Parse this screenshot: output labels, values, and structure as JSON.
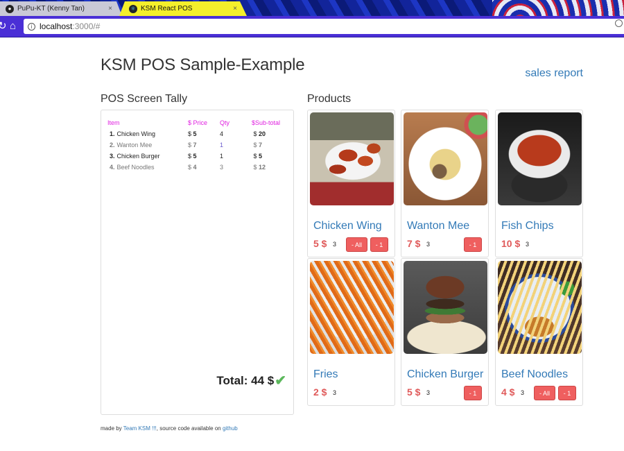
{
  "browser": {
    "tabs": [
      {
        "label": "PuPu-KT (Kenny Tan)",
        "close": "×",
        "active": false
      },
      {
        "label": "KSM React POS",
        "close": "×",
        "active": true
      }
    ],
    "url_host": "localhost",
    "url_path": ":3000/#"
  },
  "page": {
    "title": "KSM POS Sample-Example",
    "sales_report_link": "sales report",
    "tally_heading": "POS Screen Tally",
    "products_heading": "Products"
  },
  "tally": {
    "headers": {
      "item": "Item",
      "price": "$ Price",
      "qty": "Qty",
      "subtotal": "$Sub-total"
    },
    "rows": [
      {
        "idx": "1.",
        "item": "Chicken Wing",
        "price_sym": "$",
        "price": "5",
        "qty": "4",
        "sub_sym": "$",
        "subtotal": "20"
      },
      {
        "idx": "2.",
        "item": "Wanton Mee",
        "price_sym": "$",
        "price": "7",
        "qty": "1",
        "sub_sym": "$",
        "subtotal": "7"
      },
      {
        "idx": "3.",
        "item": "Chicken Burger",
        "price_sym": "$",
        "price": "5",
        "qty": "1",
        "sub_sym": "$",
        "subtotal": "5"
      },
      {
        "idx": "4.",
        "item": "Beef Noodles",
        "price_sym": "$",
        "price": "4",
        "qty": "3",
        "sub_sym": "$",
        "subtotal": "12"
      }
    ],
    "total_label": "Total: 44 $",
    "check_icon": "✔"
  },
  "products": [
    {
      "name": "Chicken Wing",
      "price": "5 $",
      "qty": "3",
      "btn_all": "- All",
      "btn_one": "- 1"
    },
    {
      "name": "Wanton Mee",
      "price": "7 $",
      "qty": "3",
      "btn_one": "- 1"
    },
    {
      "name": "Fish Chips",
      "price": "10 $",
      "qty": "3"
    },
    {
      "name": "Fries",
      "price": "2 $",
      "qty": "3"
    },
    {
      "name": "Chicken Burger",
      "price": "5 $",
      "qty": "3",
      "btn_one": "- 1"
    },
    {
      "name": "Beef Noodles",
      "price": "4 $",
      "qty": "3",
      "btn_all": "- All",
      "btn_one": "- 1"
    }
  ],
  "footer": {
    "prefix": "made by ",
    "team_link": "Team KSM !!!",
    "middle": ", source code available on ",
    "github_link": "github"
  },
  "colors": {
    "link": "#337ab7",
    "price": "#e05a5a",
    "button": "#ef5f5f",
    "header_pink": "#e01fe0",
    "check": "#5cb85c"
  }
}
